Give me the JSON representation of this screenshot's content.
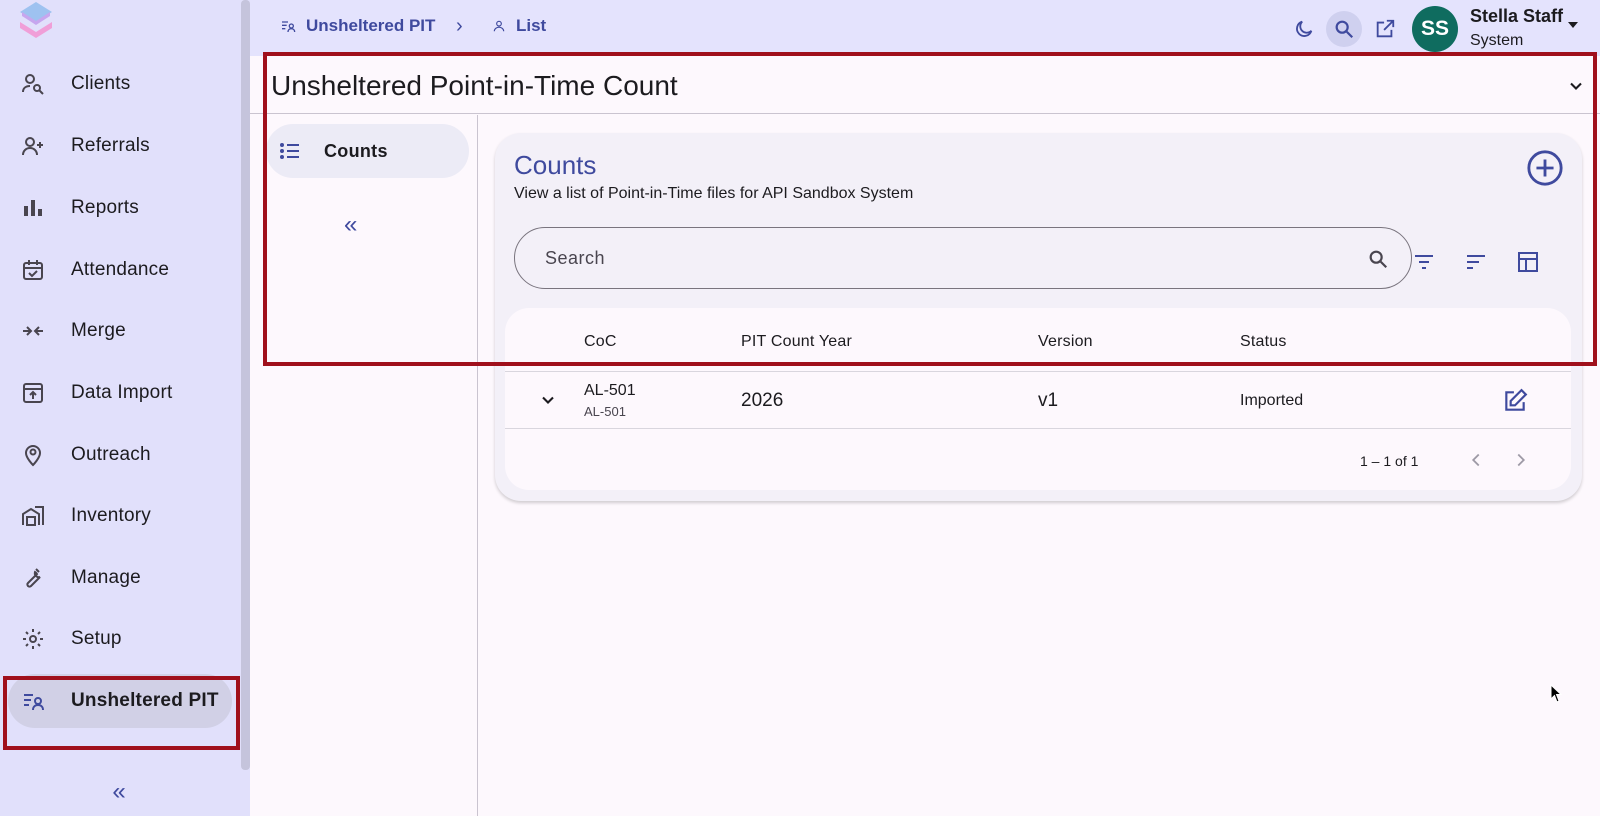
{
  "sidebar": {
    "items": [
      {
        "label": "Clients",
        "icon": "client-search-icon"
      },
      {
        "label": "Referrals",
        "icon": "person-add-icon"
      },
      {
        "label": "Reports",
        "icon": "bar-chart-icon"
      },
      {
        "label": "Attendance",
        "icon": "calendar-check-icon"
      },
      {
        "label": "Merge",
        "icon": "merge-icon"
      },
      {
        "label": "Data Import",
        "icon": "upload-box-icon"
      },
      {
        "label": "Outreach",
        "icon": "location-person-icon"
      },
      {
        "label": "Inventory",
        "icon": "warehouse-icon"
      },
      {
        "label": "Manage",
        "icon": "wrench-icon"
      },
      {
        "label": "Setup",
        "icon": "gear-icon"
      },
      {
        "label": "Unsheltered PIT",
        "icon": "person-list-icon",
        "active": true
      }
    ],
    "collapse_glyph": "«"
  },
  "topbar": {
    "breadcrumb": [
      {
        "label": "Unsheltered PIT",
        "icon": "person-list-icon"
      },
      {
        "label": "List",
        "icon": "person-icon"
      }
    ],
    "separator": "›",
    "user": {
      "initials": "SS",
      "name": "Stella Staff",
      "role": "System"
    }
  },
  "header": {
    "title": "Unsheltered Point-in-Time Count"
  },
  "inner_nav": {
    "label": "Counts",
    "collapse_glyph": "«"
  },
  "card": {
    "title": "Counts",
    "subtitle": "View a list of Point-in-Time files for API Sandbox System",
    "search_placeholder": "Search",
    "table": {
      "columns": [
        "CoC",
        "PIT Count Year",
        "Version",
        "Status"
      ],
      "rows": [
        {
          "coc": "AL-501",
          "coc_sub": "AL-501",
          "year": "2026",
          "version": "v1",
          "status": "Imported"
        }
      ]
    },
    "pager": "1 – 1 of 1"
  },
  "colors": {
    "accent": "#3f4a9e",
    "highlight": "#a0101c",
    "avatar": "#0f6c5f",
    "sidebar_bg": "#e1e0fb"
  }
}
